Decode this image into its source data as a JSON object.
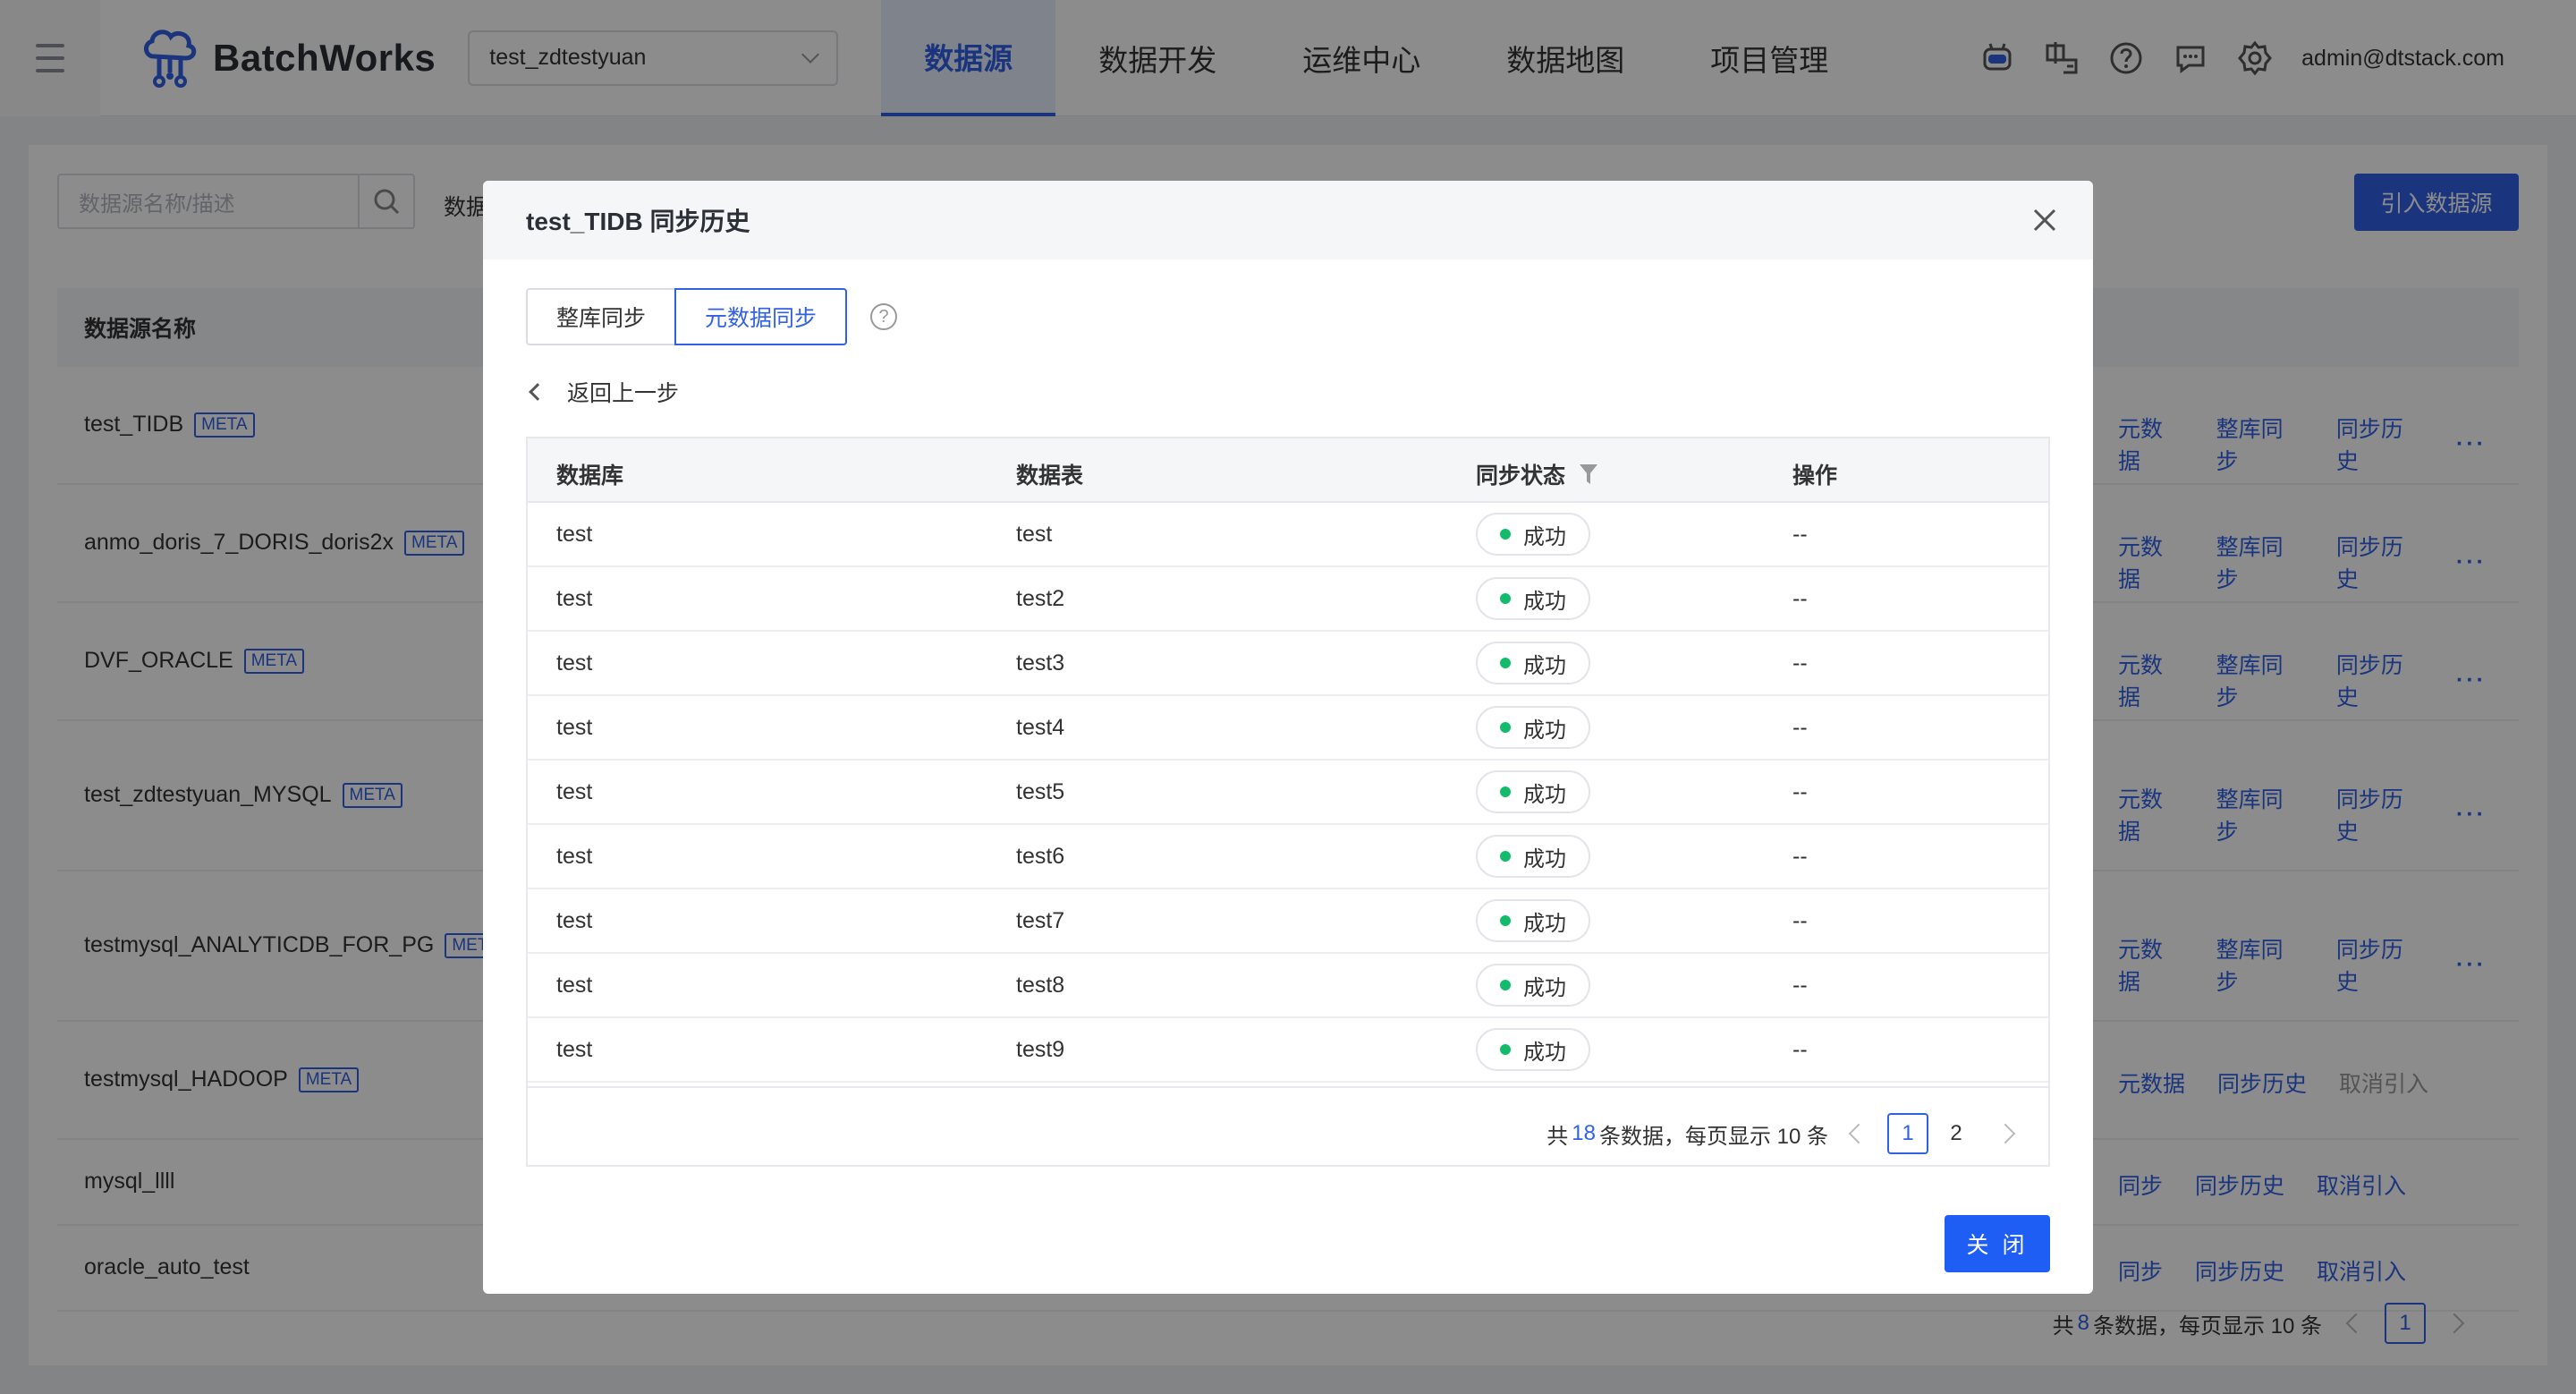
{
  "header": {
    "brand": "BatchWorks",
    "project": "test_zdtestyuan",
    "nav": [
      "数据源",
      "数据开发",
      "运维中心",
      "数据地图",
      "项目管理"
    ],
    "user": "admin@dtstack.com"
  },
  "page": {
    "search_placeholder": "数据源名称/描述",
    "filter_label": "数据",
    "import_button": "引入数据源",
    "column_name": "数据源名称",
    "rows": [
      {
        "name": "test_TIDB",
        "tag": "META",
        "actions": [
          "元数据",
          "整库同步",
          "同步历史",
          "···"
        ]
      },
      {
        "name": "anmo_doris_7_DORIS_doris2x",
        "tag": "META",
        "actions": [
          "元数据",
          "整库同步",
          "同步历史",
          "···"
        ]
      },
      {
        "name": "DVF_ORACLE",
        "tag": "META",
        "actions": [
          "元数据",
          "整库同步",
          "同步历史",
          "···"
        ]
      },
      {
        "name": "test_zdtestyuan_MYSQL",
        "tag": "META",
        "actions": [
          "元数据",
          "整库同步",
          "同步历史",
          "···"
        ]
      },
      {
        "name": "testmysql_ANALYTICDB_FOR_PG",
        "tag": "META",
        "actions": [
          "元数据",
          "整库同步",
          "同步历史",
          "···"
        ]
      },
      {
        "name": "testmysql_HADOOP",
        "tag": "META",
        "actions": [
          "元数据",
          "同步历史",
          "取消引入"
        ]
      },
      {
        "name": "mysql_llll",
        "tag": "",
        "actions": [
          "同步",
          "同步历史",
          "取消引入"
        ]
      },
      {
        "name": "oracle_auto_test",
        "tag": "",
        "actions": [
          "同步",
          "同步历史",
          "取消引入"
        ]
      }
    ],
    "pager": {
      "prefix": "共",
      "total": "8",
      "suffix": "条数据，每页显示 10 条",
      "current": "1"
    }
  },
  "modal": {
    "title": "test_TIDB 同步历史",
    "tabs": [
      "整库同步",
      "元数据同步"
    ],
    "back": "返回上一步",
    "columns": [
      "数据库",
      "数据表",
      "同步状态",
      "操作"
    ],
    "rows": [
      {
        "db": "test",
        "table": "test",
        "status": "成功",
        "op": "--"
      },
      {
        "db": "test",
        "table": "test2",
        "status": "成功",
        "op": "--"
      },
      {
        "db": "test",
        "table": "test3",
        "status": "成功",
        "op": "--"
      },
      {
        "db": "test",
        "table": "test4",
        "status": "成功",
        "op": "--"
      },
      {
        "db": "test",
        "table": "test5",
        "status": "成功",
        "op": "--"
      },
      {
        "db": "test",
        "table": "test6",
        "status": "成功",
        "op": "--"
      },
      {
        "db": "test",
        "table": "test7",
        "status": "成功",
        "op": "--"
      },
      {
        "db": "test",
        "table": "test8",
        "status": "成功",
        "op": "--"
      },
      {
        "db": "test",
        "table": "test9",
        "status": "成功",
        "op": "--"
      }
    ],
    "pager": {
      "prefix": "共",
      "total": "18",
      "suffix": "条数据，每页显示 10 条",
      "pages": [
        "1",
        "2"
      ]
    },
    "close_button": "关 闭"
  },
  "colors": {
    "accent": "#3162e6",
    "success": "#12bc6a"
  }
}
